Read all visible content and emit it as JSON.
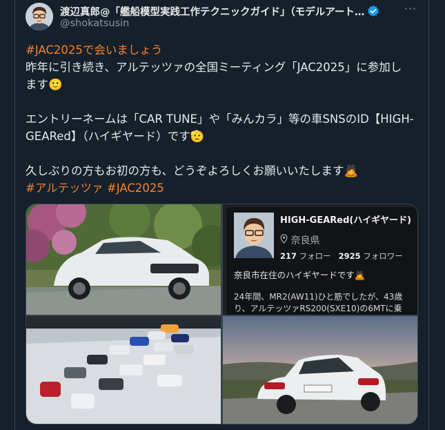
{
  "tweet": {
    "author": {
      "display_name": "渡辺真郎@「艦船模型実践工作テクニックガイド」（モデルアート…",
      "handle": "@shokatsusin",
      "verified": true
    },
    "hashtag_top": "#JAC2025で会いましょう",
    "line1": "昨年に引き続き、アルテッツァの全国ミーティング「JAC2025」に参加し",
    "line2": "ます🙂",
    "line3": "エントリーネームは「CAR TUNE」や「みんカラ」等の車SNSのID【HIGH-",
    "line4": "GEARed】（ハイギヤード）です🫡",
    "line5": "久しぶりの方もお初の方も、どうぞよろしくお願いいたします🙇",
    "hashtag_1": "#アルテッツァ",
    "hashtag_2": "#JAC2025",
    "more_label": "···"
  },
  "media": {
    "profile_card": {
      "name": "HIGH-GEARed(ハイギヤード)",
      "location": "奈良県",
      "following_count": "217",
      "following_label": "フォロー",
      "followers_count": "2925",
      "followers_label": "フォロワー",
      "bio": "奈良市在住のハイギヤードです🙇",
      "bio_line2": "24年間、MR2(AW11)ひと筋でしたが、43歳",
      "bio_line3": "り、アルテッツァRS200(SXE10)の6MTに乗"
    }
  },
  "colors": {
    "background": "#15202b",
    "hashtag": "#f4822d",
    "verified": "#1d9bf0",
    "secondary_text": "#8b98a5",
    "border": "#38444d"
  },
  "icons": [
    "verified-badge-icon",
    "more-icon",
    "location-pin-icon"
  ]
}
